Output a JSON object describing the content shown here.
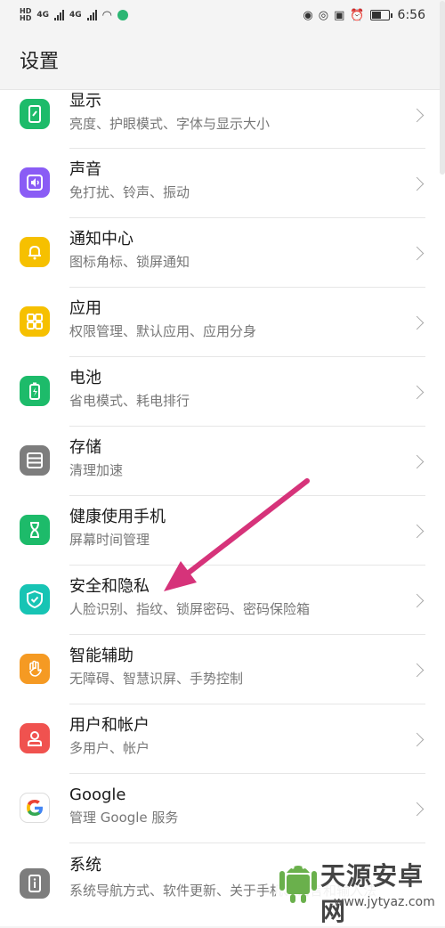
{
  "status_bar": {
    "hd1": "HD",
    "hd2": "HD",
    "net1": "4G",
    "net2": "4G",
    "time": "6:56",
    "battery_level": 0.6
  },
  "header": {
    "title": "设置"
  },
  "items": [
    {
      "title": "显示",
      "subtitle": "亮度、护眼模式、字体与显示大小",
      "icon": "display-icon",
      "color": "#1dbb6a"
    },
    {
      "title": "声音",
      "subtitle": "免打扰、铃声、振动",
      "icon": "sound-icon",
      "color": "#8a5cf5"
    },
    {
      "title": "通知中心",
      "subtitle": "图标角标、锁屏通知",
      "icon": "bell-icon",
      "color": "#f6c000"
    },
    {
      "title": "应用",
      "subtitle": "权限管理、默认应用、应用分身",
      "icon": "apps-grid-icon",
      "color": "#f6c000"
    },
    {
      "title": "电池",
      "subtitle": "省电模式、耗电排行",
      "icon": "battery-icon",
      "color": "#1dbb6a"
    },
    {
      "title": "存储",
      "subtitle": "清理加速",
      "icon": "storage-icon",
      "color": "#7d7d7d"
    },
    {
      "title": "健康使用手机",
      "subtitle": "屏幕时间管理",
      "icon": "hourglass-icon",
      "color": "#1dbb6a"
    },
    {
      "title": "安全和隐私",
      "subtitle": "人脸识别、指纹、锁屏密码、密码保险箱",
      "icon": "shield-icon",
      "color": "#17c4b4"
    },
    {
      "title": "智能辅助",
      "subtitle": "无障碍、智慧识屏、手势控制",
      "icon": "hand-icon",
      "color": "#f59a23"
    },
    {
      "title": "用户和帐户",
      "subtitle": "多用户、帐户",
      "icon": "user-icon",
      "color": "#f0524f"
    },
    {
      "title": "Google",
      "subtitle": "管理 Google 服务",
      "icon": "google-icon",
      "color": "#ffffff"
    },
    {
      "title": "系统",
      "subtitle": "系统导航方式、软件更新、关于手机、语言和输入法",
      "icon": "system-info-icon",
      "color": "#7d7d7d"
    }
  ],
  "watermark": {
    "name": "天源安卓网",
    "url": "www.jytyaz.com"
  },
  "colors": {
    "arrow": "#d6337a"
  }
}
